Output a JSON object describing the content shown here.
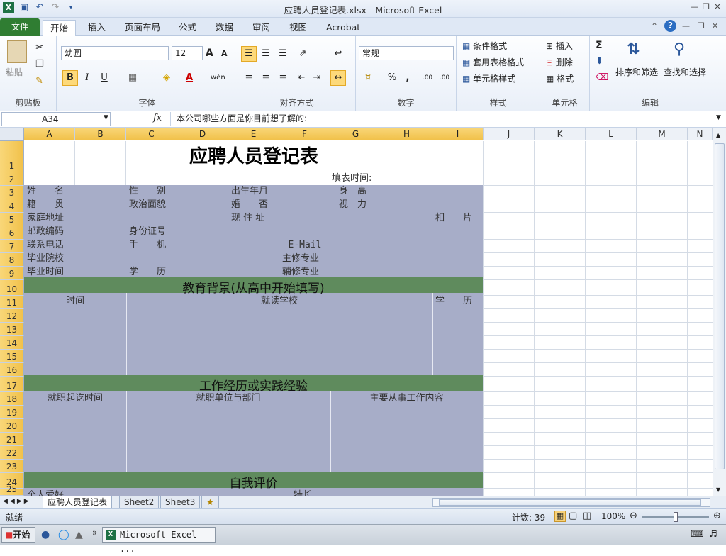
{
  "window": {
    "title": "应聘人员登记表.xlsx - Microsoft Excel"
  },
  "ribbon_tabs": [
    "文件",
    "开始",
    "插入",
    "页面布局",
    "公式",
    "数据",
    "审阅",
    "视图",
    "Acrobat"
  ],
  "clipboard": {
    "paste": "粘贴",
    "label": "剪贴板"
  },
  "font": {
    "name": "幼圆",
    "size": "12",
    "label": "字体",
    "bold": "B",
    "italic": "I",
    "underline": "U",
    "grow": "A",
    "shrink": "A",
    "wen": "wén"
  },
  "alignment": {
    "label": "对齐方式"
  },
  "number": {
    "format": "常规",
    "label": "数字",
    "percent": "%",
    "comma": ",",
    "inc": ".00",
    "dec": ".00"
  },
  "styles": {
    "cond": "条件格式",
    "table": "套用表格格式",
    "cell": "单元格样式",
    "label": "样式"
  },
  "cells": {
    "insert": "插入",
    "delete": "删除",
    "format": "格式",
    "label": "单元格"
  },
  "editing": {
    "sort": "排序和筛选",
    "find": "查找和选择",
    "label": "编辑",
    "sigma": "Σ"
  },
  "formula_bar": {
    "name_box": "A34",
    "fx": "fx",
    "content": "本公司哪些方面是你目前想了解的:"
  },
  "columns": [
    "A",
    "B",
    "C",
    "D",
    "E",
    "F",
    "G",
    "H",
    "I",
    "J",
    "K",
    "L",
    "M",
    "N"
  ],
  "rows": [
    "1",
    "2",
    "3",
    "4",
    "5",
    "6",
    "7",
    "8",
    "9",
    "10",
    "11",
    "12",
    "13",
    "14",
    "15",
    "16",
    "17",
    "18",
    "19",
    "20",
    "21",
    "22",
    "23",
    "24",
    "25"
  ],
  "sheet": {
    "title": "应聘人员登记表",
    "fill_time": "填表时间:",
    "name": "姓　　名",
    "gender": "性　　别",
    "birth": "出生年月",
    "height": "身　高",
    "origin": "籍　　贯",
    "politics": "政治面貌",
    "marital": "婚　　否",
    "vision": "视　力",
    "address": "家庭地址",
    "current_address": "现 住 址",
    "photo": "相　　片",
    "postcode": "邮政编码",
    "id_card": "身份证号",
    "phone": "联系电话",
    "mobile": "手　　机",
    "email": "E-Mail",
    "school": "毕业院校",
    "major": "主修专业",
    "grad_time": "毕业时间",
    "degree": "学　　历",
    "minor": "辅修专业",
    "edu_header": "教育背景(从高中开始填写)",
    "edu_time": "时间",
    "edu_school": "就读学校",
    "edu_degree": "学　　历",
    "work_header": "工作经历或实践经验",
    "work_time": "就职起讫时间",
    "work_unit": "就职单位与部门",
    "work_content": "主要从事工作内容",
    "self_header": "自我评价",
    "hobby": "个人爱好",
    "strength": "特长"
  },
  "sheet_tabs": [
    "应聘人员登记表",
    "Sheet2",
    "Sheet3"
  ],
  "status": {
    "ready": "就绪",
    "count": "计数: 39",
    "zoom": "100%"
  },
  "taskbar": {
    "start": "开始",
    "app": "Microsoft Excel - ..."
  },
  "colors": {
    "green_band": "#5f8b5d",
    "cell_shade": "#a7adc8",
    "file_tab": "#2f7d32"
  }
}
